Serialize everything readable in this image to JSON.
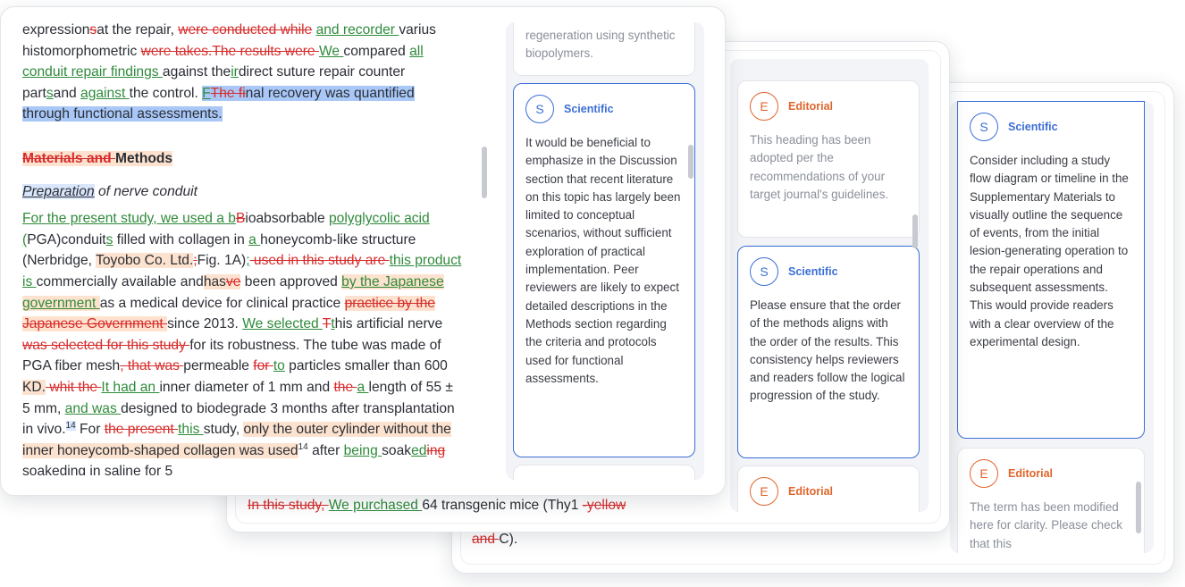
{
  "manuscript": {
    "p1": {
      "s01": "expression",
      "s02": "s",
      "s03": "at the repair, ",
      "s04": "were conducted while",
      "s05": " ",
      "s06": "and recorder ",
      "s07": "varius histomorphometric ",
      "s08": "were takes.",
      "s09": "The results were ",
      "s10": "We ",
      "s11": "compared ",
      "s12": "all conduit repair findings ",
      "s13": "against the",
      "s14": "ir",
      "s15": "direct suture repair counter part",
      "s16": "s",
      "s17": "and ",
      "s18": "against ",
      "s19": "the control. ",
      "s20": "F",
      "s21": "The fi",
      "s22": "nal recovery was quantified through functional assessments."
    },
    "heading": {
      "del": "Materials and ",
      "text": "Methods"
    },
    "subheading": {
      "part1": "Preparation",
      "part2": " of nerve conduit"
    },
    "p2": {
      "s01": "For the present study, we used a b",
      "s02": "B",
      "s03": "ioabsorbable ",
      "s04": "polyglycolic acid (",
      "s05": "PGA)",
      "s06": "conduit",
      "s07": "s",
      "s08": " filled with collagen in ",
      "s09": "a ",
      "s10": "honeycomb-like structure (Nerbridge, ",
      "s11": "Toyobo Co. Ltd.",
      "s12": ";",
      "s13": "Fig. 1A)",
      "s14": ";",
      "s15": " used in this study are ",
      "s16": "this product is ",
      "s17": "commercially available and",
      "s18": "has",
      "s19": "ve",
      "s20": " been approved ",
      "s21": "by the Japanese government ",
      "s22": "as a medical device for clinical practice ",
      "s23": "practice by the Japanese Government ",
      "s24": "since 2013. ",
      "s25": "We selected ",
      "s26": "T",
      "s27": "t",
      "s28": "his artificial nerve ",
      "s29": "was selected for this study ",
      "s30": "for its robustness. The tube was made of PGA fiber mesh",
      "s31": ", that was ",
      "s32": "permeable ",
      "s33": "for ",
      "s34": "to",
      "s35": " particles smaller than 600 ",
      "s36": "KD.",
      "s37": " whit the ",
      "s38": "It had an ",
      "s39": "inner diameter of 1 mm and ",
      "s40": "the ",
      "s41": "a ",
      "s42": "length of 55 ± 5 mm, ",
      "s43": "and was ",
      "s44": "designed to biodegrade 3 months after transplantation in vivo.",
      "s45": "14",
      "s46": " For ",
      "s47": "the present ",
      "s48": "this ",
      "s49": "study, ",
      "s50": "only the outer cylinder without the inner honeycomb-shaped collagen was used",
      "s51": "14",
      "s52": " after ",
      "s53": "being ",
      "s54": "soak",
      "s55": "ed",
      "s56": "ing",
      "s57": " soakeding in saline for 5"
    }
  },
  "card2_fragment": {
    "del1": "In this study, ",
    "ins1": "We purchased ",
    "text1": "64 transgenic mice (Thy1 ",
    "del2": "-yellow"
  },
  "card3_fragment": {
    "del1": "and ",
    "text1": "C)."
  },
  "card1_comments": [
    {
      "text": "regeneration using synthetic biopolymers."
    },
    {
      "badge": "S",
      "category": "Scientific",
      "text": "It would be beneficial to emphasize in the Discussion section that recent literature on this topic has largely been limited to conceptual scenarios, without sufficient exploration of practical implementation. Peer reviewers are likely to expect detailed descriptions in the Methods section regarding the criteria and protocols used for functional assessments."
    }
  ],
  "card2_comments": [
    {
      "badge": "E",
      "category": "Editorial",
      "text": "This heading has been adopted per the recommendations of your target journal's guidelines."
    },
    {
      "badge": "S",
      "category": "Scientific",
      "text": "Please ensure that the order of the methods aligns with the order of the results. This consistency helps reviewers and readers follow the logical progression of the study."
    },
    {
      "badge": "E",
      "category": "Editorial"
    }
  ],
  "card3_comments": [
    {
      "badge": "S",
      "category": "Scientific",
      "text": "Consider including a study flow diagram or timeline in the Supplementary Materials to visually outline the sequence of events, from the initial lesion-generating operation to the repair operations and subsequent assessments. This would provide readers with a clear overview of the experimental design."
    },
    {
      "badge": "E",
      "category": "Editorial",
      "text": "The term has been modified here for clarity. Please check that this"
    }
  ],
  "colors": {
    "deletion": "#d62c2c",
    "insertion": "#2e8a3a",
    "scientific": "#3b6ed6",
    "editorial": "#e0652c",
    "highlight_orange": "#fde3cf",
    "highlight_blue": "#a9c8f7"
  }
}
